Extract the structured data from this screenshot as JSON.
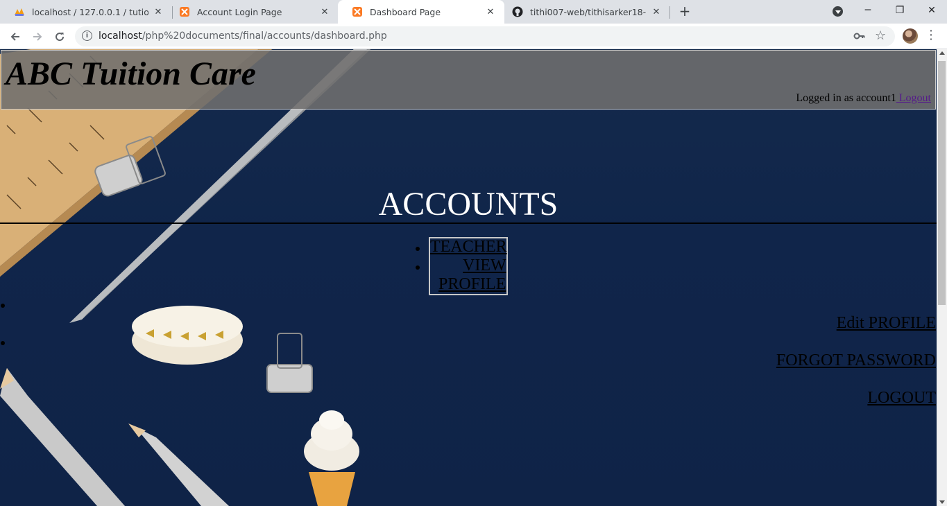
{
  "browser": {
    "tabs": [
      {
        "title": "localhost / 127.0.0.1 / tution_mar",
        "icon": "phpmyadmin-icon",
        "active": false
      },
      {
        "title": "Account Login Page",
        "icon": "xampp-icon",
        "active": false
      },
      {
        "title": "Dashboard Page",
        "icon": "xampp-icon",
        "active": true
      },
      {
        "title": "tithi007-web/tithisarker18-38418",
        "icon": "github-icon",
        "active": false
      }
    ],
    "url_host": "localhost",
    "url_path": "/php%20documents/final/accounts/dashboard.php"
  },
  "page": {
    "site_title": "ABC Tuition Care",
    "logged_in_text": "Logged in as account1",
    "logout_link": " Logout",
    "heading": "ACCOUNTS",
    "menu": {
      "teacher": "TEACHER",
      "view": "VIEW",
      "profile": "PROFILE",
      "edit_profile": "Edit PROFILE",
      "forgot_password": "FORGOT PASSWORD",
      "logout": "LOGOUT"
    }
  },
  "colors": {
    "header_bg": "#706e6e",
    "page_bg": "#10254a",
    "visited_link": "#551a8b"
  }
}
